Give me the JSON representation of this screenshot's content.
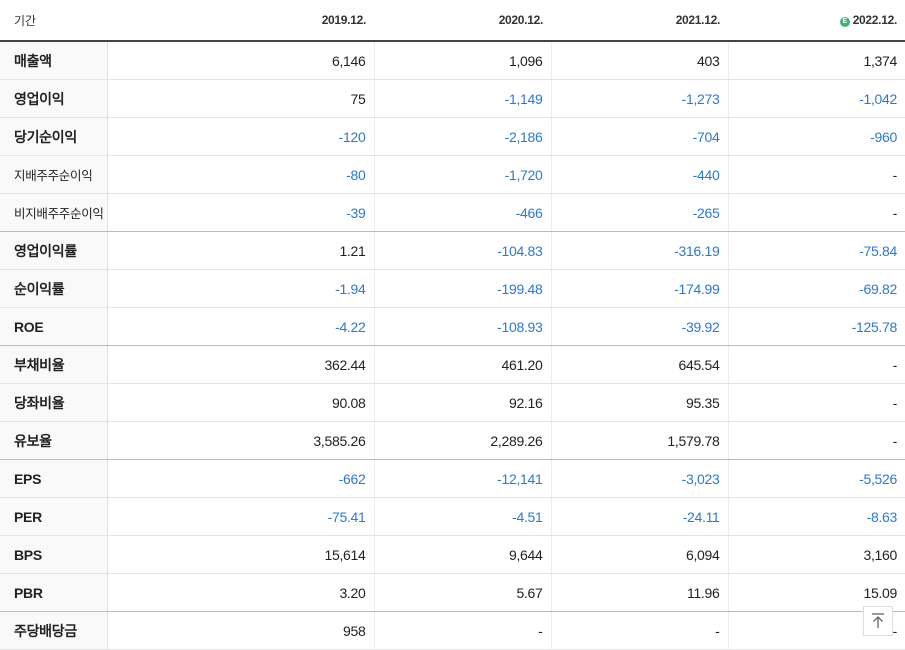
{
  "header": {
    "period_label": "기간",
    "periods": [
      "2019.12.",
      "2020.12.",
      "2021.12.",
      "2022.12."
    ],
    "estimate_icon": "Ⓔ",
    "estimate_icon_color": "#3bb56f"
  },
  "colors": {
    "negative": "#2a7ad3",
    "normal": "#222222"
  },
  "rows": [
    {
      "label": "매출액",
      "values": [
        "6,146",
        "1,096",
        "403",
        "1,374"
      ]
    },
    {
      "label": "영업이익",
      "values": [
        "75",
        "-1,149",
        "-1,273",
        "-1,042"
      ]
    },
    {
      "label": "당기순이익",
      "values": [
        "-120",
        "-2,186",
        "-704",
        "-960"
      ]
    },
    {
      "label": "지배주주순이익",
      "values": [
        "-80",
        "-1,720",
        "-440",
        "-"
      ]
    },
    {
      "label": "비지배주주순이익",
      "values": [
        "-39",
        "-466",
        "-265",
        "-"
      ]
    },
    {
      "label": "영업이익률",
      "values": [
        "1.21",
        "-104.83",
        "-316.19",
        "-75.84"
      ]
    },
    {
      "label": "순이익률",
      "values": [
        "-1.94",
        "-199.48",
        "-174.99",
        "-69.82"
      ]
    },
    {
      "label": "ROE",
      "values": [
        "-4.22",
        "-108.93",
        "-39.92",
        "-125.78"
      ]
    },
    {
      "label": "부채비율",
      "values": [
        "362.44",
        "461.20",
        "645.54",
        "-"
      ]
    },
    {
      "label": "당좌비율",
      "values": [
        "90.08",
        "92.16",
        "95.35",
        "-"
      ]
    },
    {
      "label": "유보율",
      "values": [
        "3,585.26",
        "2,289.26",
        "1,579.78",
        "-"
      ]
    },
    {
      "label": "EPS",
      "values": [
        "-662",
        "-12,141",
        "-3,023",
        "-5,526"
      ]
    },
    {
      "label": "PER",
      "values": [
        "-75.41",
        "-4.51",
        "-24.11",
        "-8.63"
      ]
    },
    {
      "label": "BPS",
      "values": [
        "15,614",
        "9,644",
        "6,094",
        "3,160"
      ]
    },
    {
      "label": "PBR",
      "values": [
        "3.20",
        "5.67",
        "11.96",
        "15.09"
      ]
    },
    {
      "label": "주당배당금",
      "values": [
        "958",
        "-",
        "-",
        "-"
      ]
    }
  ],
  "scroll_top_icon": "arrow-up-to-top"
}
